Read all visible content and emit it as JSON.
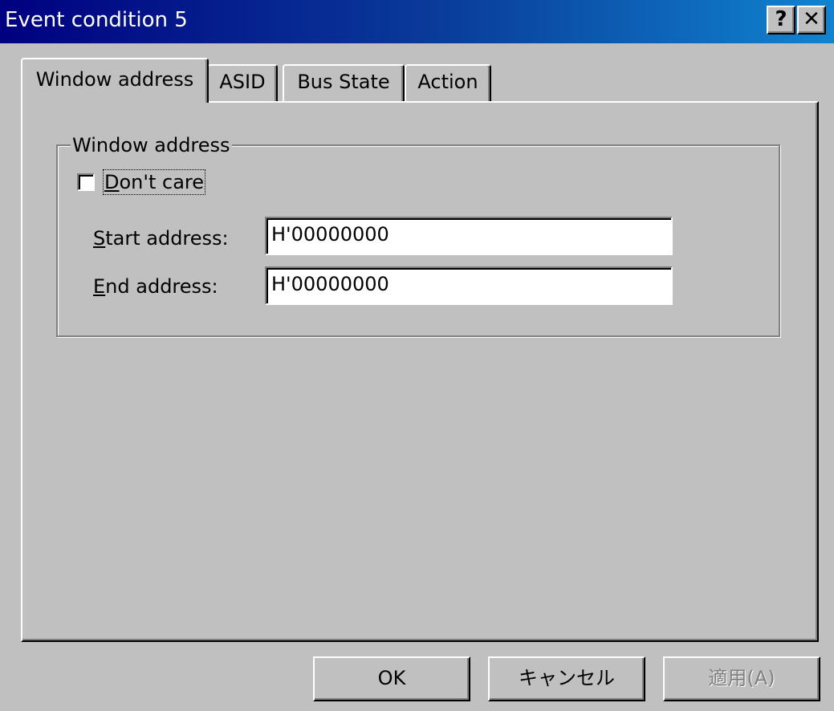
{
  "window": {
    "title": "Event condition 5",
    "help_label": "?",
    "close_label": "✕",
    "title_gradient_start": "#000080",
    "title_gradient_end": "#1084d0"
  },
  "tabs": [
    {
      "label": "Window address",
      "active": true
    },
    {
      "label": "ASID",
      "active": false
    },
    {
      "label": "Bus State",
      "active": false
    },
    {
      "label": "Action",
      "active": false
    }
  ],
  "group": {
    "legend": "Window address",
    "checkbox": {
      "label_mnemonic": "D",
      "label_rest": "on't care",
      "checked": false
    },
    "start": {
      "label_mnemonic": "S",
      "label_rest": "tart address:",
      "value": "H'00000000"
    },
    "end": {
      "label_mnemonic": "E",
      "label_rest": "nd address:",
      "value": "H'00000000"
    }
  },
  "buttons": {
    "ok": "OK",
    "cancel": "キャンセル",
    "apply": "適用(A)",
    "apply_enabled": false
  }
}
